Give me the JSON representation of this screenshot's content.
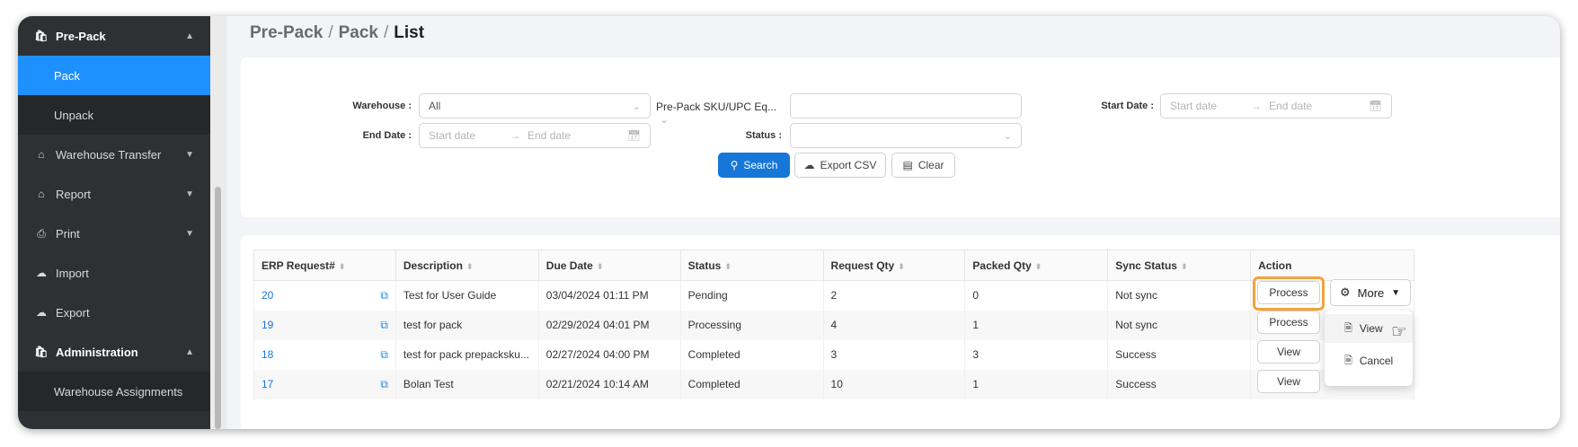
{
  "sidebar": {
    "items": [
      {
        "label": "Pre-Pack",
        "icon": "bag-icon",
        "expanded": true
      },
      {
        "label": "Pack",
        "active": true
      },
      {
        "label": "Unpack"
      },
      {
        "label": "Warehouse Transfer",
        "icon": "warehouse-icon"
      },
      {
        "label": "Report",
        "icon": "report-icon"
      },
      {
        "label": "Print",
        "icon": "printer-icon"
      },
      {
        "label": "Import",
        "icon": "cloud-upload-icon"
      },
      {
        "label": "Export",
        "icon": "cloud-upload-icon"
      },
      {
        "label": "Administration",
        "icon": "bag-icon",
        "expanded": true
      },
      {
        "label": "Warehouse Assignments"
      }
    ]
  },
  "breadcrumb": {
    "part1": "Pre-Pack",
    "part2": "Pack",
    "current": "List",
    "sep": "/"
  },
  "filters": {
    "warehouse_label": "Warehouse :",
    "warehouse_value": "All",
    "sku_label": "Pre-Pack SKU/UPC Eq...",
    "sku_value": "",
    "start_label": "Start Date :",
    "start_placeholder": "Start date",
    "end_placeholder": "End date",
    "end_label": "End Date :",
    "status_label": "Status :",
    "status_value": "",
    "arrow": "→"
  },
  "buttons": {
    "search": "Search",
    "export_csv": "Export CSV",
    "clear": "Clear"
  },
  "table": {
    "columns": [
      "ERP Request#",
      "Description",
      "Due Date",
      "Status",
      "Request Qty",
      "Packed Qty",
      "Sync Status",
      "Action"
    ],
    "rows": [
      {
        "erp": "20",
        "description": "Test for User Guide",
        "due": "03/04/2024 01:11 PM",
        "status": "Pending",
        "req": "2",
        "packed": "0",
        "sync": "Not sync",
        "action": "Process"
      },
      {
        "erp": "19",
        "description": "test for pack",
        "due": "02/29/2024 04:01 PM",
        "status": "Processing",
        "req": "4",
        "packed": "1",
        "sync": "Not sync",
        "action": "Process"
      },
      {
        "erp": "18",
        "description": "test for pack prepacksku...",
        "due": "02/27/2024 04:00 PM",
        "status": "Completed",
        "req": "3",
        "packed": "3",
        "sync": "Success",
        "action": "View"
      },
      {
        "erp": "17",
        "description": "Bolan Test",
        "due": "02/21/2024 10:14 AM",
        "status": "Completed",
        "req": "10",
        "packed": "1",
        "sync": "Success",
        "action": "View"
      }
    ]
  },
  "more_menu": {
    "label": "More",
    "items": [
      "View",
      "Cancel"
    ]
  },
  "colors": {
    "accent": "#1677d8",
    "sidebar_bg": "#2e3033",
    "highlight": "#f2a33a"
  }
}
